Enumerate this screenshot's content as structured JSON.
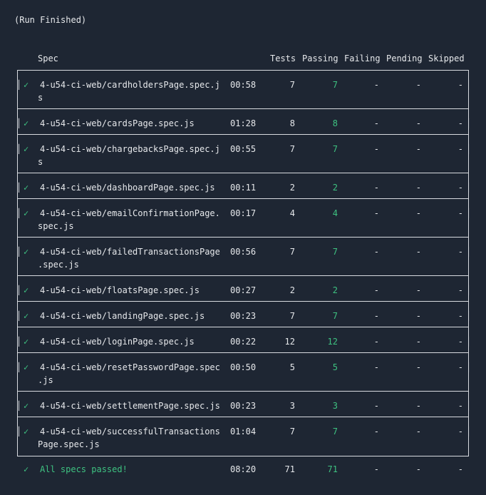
{
  "run_status": "(Run Finished)",
  "header": {
    "spec": "Spec",
    "tests": "Tests",
    "passing": "Passing",
    "failing": "Failing",
    "pending": "Pending",
    "skipped": "Skipped"
  },
  "rows": [
    {
      "name1": "4-u54-ci-web/cardholdersPage.spec.j",
      "name2": "s",
      "time": "00:58",
      "tests": "7",
      "passing": "7",
      "failing": "-",
      "pending": "-",
      "skipped": "-"
    },
    {
      "name1": "4-u54-ci-web/cardsPage.spec.js",
      "name2": "",
      "time": "01:28",
      "tests": "8",
      "passing": "8",
      "failing": "-",
      "pending": "-",
      "skipped": "-"
    },
    {
      "name1": "4-u54-ci-web/chargebacksPage.spec.j",
      "name2": "s",
      "time": "00:55",
      "tests": "7",
      "passing": "7",
      "failing": "-",
      "pending": "-",
      "skipped": "-"
    },
    {
      "name1": "4-u54-ci-web/dashboardPage.spec.js",
      "name2": "",
      "time": "00:11",
      "tests": "2",
      "passing": "2",
      "failing": "-",
      "pending": "-",
      "skipped": "-"
    },
    {
      "name1": "4-u54-ci-web/emailConfirmationPage.",
      "name2": "spec.js",
      "time": "00:17",
      "tests": "4",
      "passing": "4",
      "failing": "-",
      "pending": "-",
      "skipped": "-"
    },
    {
      "name1": "4-u54-ci-web/failedTransactionsPage",
      "name2": ".spec.js",
      "time": "00:56",
      "tests": "7",
      "passing": "7",
      "failing": "-",
      "pending": "-",
      "skipped": "-"
    },
    {
      "name1": "4-u54-ci-web/floatsPage.spec.js",
      "name2": "",
      "time": "00:27",
      "tests": "2",
      "passing": "2",
      "failing": "-",
      "pending": "-",
      "skipped": "-"
    },
    {
      "name1": "4-u54-ci-web/landingPage.spec.js",
      "name2": "",
      "time": "00:23",
      "tests": "7",
      "passing": "7",
      "failing": "-",
      "pending": "-",
      "skipped": "-"
    },
    {
      "name1": "4-u54-ci-web/loginPage.spec.js",
      "name2": "",
      "time": "00:22",
      "tests": "12",
      "passing": "12",
      "failing": "-",
      "pending": "-",
      "skipped": "-"
    },
    {
      "name1": "4-u54-ci-web/resetPasswordPage.spec",
      "name2": ".js",
      "time": "00:50",
      "tests": "5",
      "passing": "5",
      "failing": "-",
      "pending": "-",
      "skipped": "-"
    },
    {
      "name1": "4-u54-ci-web/settlementPage.spec.js",
      "name2": "",
      "time": "00:23",
      "tests": "3",
      "passing": "3",
      "failing": "-",
      "pending": "-",
      "skipped": "-"
    },
    {
      "name1": "4-u54-ci-web/successfulTransactions",
      "name2": "Page.spec.js",
      "time": "01:04",
      "tests": "7",
      "passing": "7",
      "failing": "-",
      "pending": "-",
      "skipped": "-"
    }
  ],
  "summary": {
    "label": "All specs passed!",
    "time": "08:20",
    "tests": "71",
    "passing": "71",
    "failing": "-",
    "pending": "-",
    "skipped": "-"
  },
  "check_glyph": "✔",
  "colors": {
    "background": "#1e2633",
    "text": "#e6e8eb",
    "pass": "#3ec281",
    "border": "#d8dbe0"
  }
}
